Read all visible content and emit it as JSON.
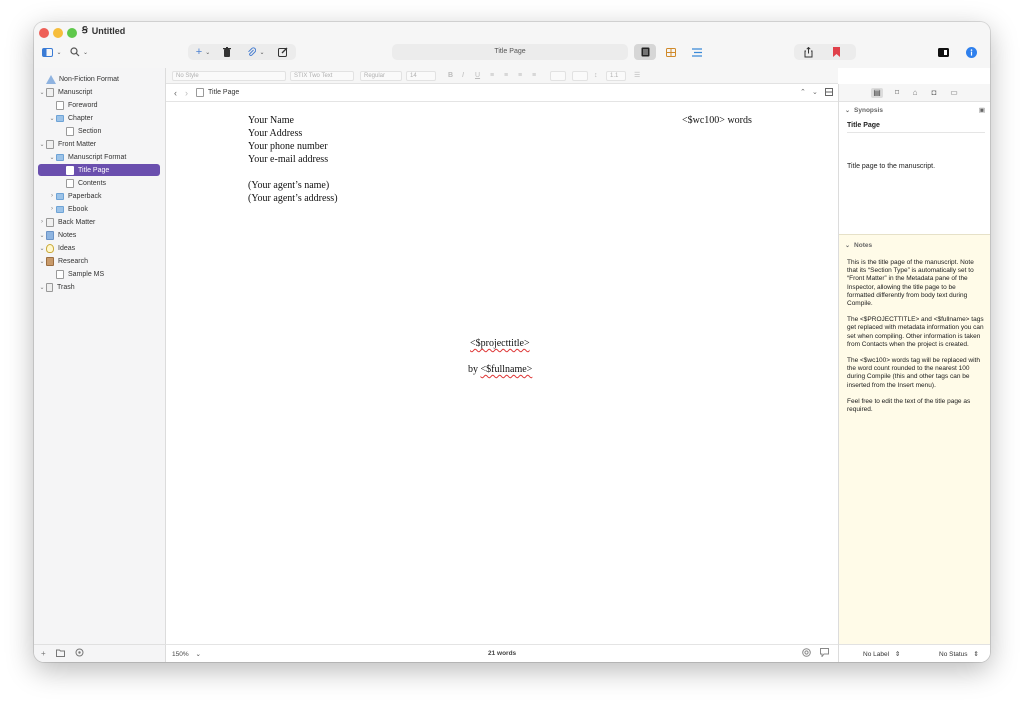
{
  "window": {
    "title": "Untitled"
  },
  "toolbar": {
    "add_label": "+",
    "center_title": "Title Page"
  },
  "format_bar": {
    "style": "No Style",
    "font": "STIX Two Text",
    "weight": "Regular",
    "size": "14",
    "line_spacing": "1.1"
  },
  "binder": {
    "items": [
      {
        "label": "Non-Fiction Format"
      },
      {
        "label": "Manuscript"
      },
      {
        "label": "Foreword"
      },
      {
        "label": "Chapter"
      },
      {
        "label": "Section"
      },
      {
        "label": "Front Matter"
      },
      {
        "label": "Manuscript Format"
      },
      {
        "label": "Title Page"
      },
      {
        "label": "Contents"
      },
      {
        "label": "Paperback"
      },
      {
        "label": "Ebook"
      },
      {
        "label": "Back Matter"
      },
      {
        "label": "Notes"
      },
      {
        "label": "Ideas"
      },
      {
        "label": "Research"
      },
      {
        "label": "Sample MS"
      },
      {
        "label": "Trash"
      }
    ]
  },
  "editor": {
    "header_title": "Title Page",
    "lines": {
      "name": "Your Name",
      "address": "Your Address",
      "phone": "Your phone number",
      "email": "Your e-mail address",
      "agent_name": "(Your agent’s name)",
      "agent_address": "(Your agent’s address)",
      "word_count_tag": "<$wc100> words",
      "project_title_tag": "<$projecttitle>",
      "by_prefix": "by ",
      "fullname_tag": "<$fullname>"
    },
    "zoom": "150%",
    "word_count": "21 words"
  },
  "inspector": {
    "synopsis_header": "Synopsis",
    "synopsis_title": "Title Page",
    "synopsis_text": "Title page to the manuscript.",
    "notes_header": "Notes",
    "notes": [
      "This is the title page of the manuscript. Note that its “Section Type” is automatically set to “Front Matter” in the Metadata pane of the Inspector, allowing the title page to be formatted differently from body text during Compile.",
      "The <$PROJECTTITLE> and <$fullname> tags get replaced with metadata information you can set when compiling. Other information is taken from Contacts when the project is created.",
      "The <$wc100> words tag will be replaced with the word count rounded to the nearest 100 during Compile (this and other tags can be inserted from the Insert menu).",
      "Feel free to edit the text of the title page as required."
    ],
    "label_value": "No Label",
    "status_value": "No Status"
  },
  "colors": {
    "selection": "#6a4fae",
    "notes_bg": "#fffbe8",
    "bookmark_red": "#e0404a",
    "info_blue": "#2f80ed"
  }
}
